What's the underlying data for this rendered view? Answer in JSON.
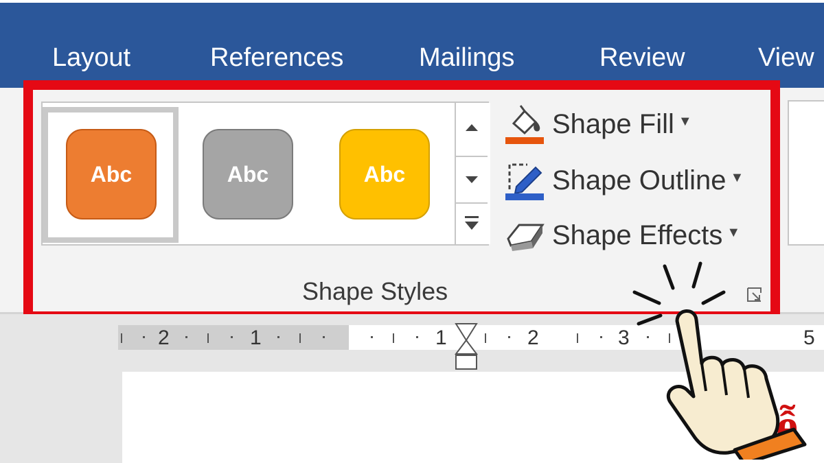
{
  "ribbon_tabs": [
    "Layout",
    "References",
    "Mailings",
    "Review",
    "View"
  ],
  "shape_styles": {
    "items": [
      {
        "label": "Abc",
        "fill": "#ed7d31",
        "border": "#c65b16"
      },
      {
        "label": "Abc",
        "fill": "#a5a5a5",
        "border": "#7b7b7b"
      },
      {
        "label": "Abc",
        "fill": "#ffc000",
        "border": "#d4a000"
      }
    ],
    "commands": [
      {
        "label": "Shape Fill",
        "icon": "paint-bucket-icon",
        "accent": "#e6550d"
      },
      {
        "label": "Shape Outline",
        "icon": "pen-outline-icon",
        "accent": "#2e5fc7"
      },
      {
        "label": "Shape Effects",
        "icon": "shape-effects-icon",
        "accent": "#888888"
      }
    ],
    "group_label": "Shape Styles"
  },
  "ruler": {
    "left_labels": [
      "2",
      "1"
    ],
    "right_labels": [
      "1",
      "2",
      "3",
      "5"
    ]
  },
  "document": {
    "fragment": "ễ"
  },
  "colors": {
    "title_bar": "#2b579a",
    "highlight": "#e50914",
    "hand_cuff": "#f08020"
  }
}
